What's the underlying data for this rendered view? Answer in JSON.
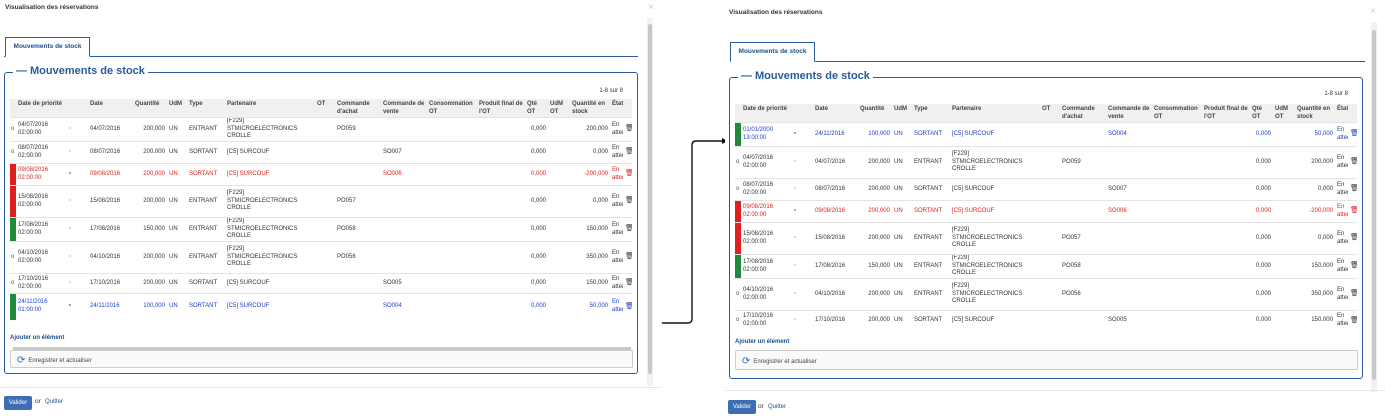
{
  "dialog_title": "Visualisation des réservations",
  "close_glyph": "×",
  "tab_label": "Mouvements de stock",
  "section_title": "Mouvements de stock",
  "count": "1-8 sur 8",
  "columns": [
    "Date de priorité",
    "Date",
    "Quantité",
    "UdM",
    "Type",
    "Partenaire",
    "OT",
    "Commande d'achat",
    "Commande de vente",
    "Consommation OT",
    "Produit final de l'OT",
    "Qté OT",
    "UdM OT",
    "Quantité en stock",
    "État"
  ],
  "add_item": "Ajouter un élément",
  "save_button": "Enregistrer et actualiser",
  "validate_button": "Valider",
  "or_text": "or",
  "quit_link": "Quitter",
  "row_colors": {
    "red": "#e02020",
    "green": "#1e8a3a",
    "blue": "#1a3ec8"
  },
  "left_rows": [
    {
      "bar": "",
      "style": "normal",
      "prio": "04/07/2016 02:00:00",
      "date": "04/07/2016",
      "qty": "200,000",
      "udm": "UN",
      "type": "ENTRANT",
      "partner": "[F229] STMICROELECTRONICS CROLLE",
      "po": "PO059",
      "so": "",
      "qte_ot": "0,000",
      "stock": "200,000",
      "state": "En attente"
    },
    {
      "bar": "",
      "style": "normal",
      "prio": "08/07/2016 02:00:00",
      "date": "08/07/2016",
      "qty": "200,000",
      "udm": "UN",
      "type": "SORTANT",
      "partner": "[C5] SURCOUF",
      "po": "",
      "so": "SO007",
      "qte_ot": "0,000",
      "stock": "0,000",
      "state": "En attente"
    },
    {
      "bar": "red",
      "style": "red",
      "prio": "09/08/2016 02:00:00",
      "date": "09/08/2016",
      "qty": "200,000",
      "udm": "UN",
      "type": "SORTANT",
      "partner": "[C5] SURCOUF",
      "po": "",
      "so": "SO006",
      "qte_ot": "0,000",
      "stock": "-200,000",
      "state": "En attente"
    },
    {
      "bar": "red",
      "style": "normal",
      "prio": "15/08/2016 02:00:00",
      "date": "15/08/2016",
      "qty": "200,000",
      "udm": "UN",
      "type": "ENTRANT",
      "partner": "[F229] STMICROELECTRONICS CROLLE",
      "po": "PO057",
      "so": "",
      "qte_ot": "0,000",
      "stock": "0,000",
      "state": "En attente"
    },
    {
      "bar": "green",
      "style": "normal",
      "prio": "17/08/2016 02:00:00",
      "date": "17/08/2016",
      "qty": "150,000",
      "udm": "UN",
      "type": "ENTRANT",
      "partner": "[F229] STMICROELECTRONICS CROLLE",
      "po": "PO058",
      "so": "",
      "qte_ot": "0,000",
      "stock": "150,000",
      "state": "En attente"
    },
    {
      "bar": "",
      "style": "normal",
      "prio": "04/10/2016 02:00:00",
      "date": "04/10/2016",
      "qty": "200,000",
      "udm": "UN",
      "type": "ENTRANT",
      "partner": "[F229] STMICROELECTRONICS CROLLE",
      "po": "PO056",
      "so": "",
      "qte_ot": "0,000",
      "stock": "350,000",
      "state": "En attente"
    },
    {
      "bar": "",
      "style": "normal",
      "prio": "17/10/2016 02:00:00",
      "date": "17/10/2016",
      "qty": "200,000",
      "udm": "UN",
      "type": "SORTANT",
      "partner": "[C5] SURCOUF",
      "po": "",
      "so": "SO005",
      "qte_ot": "0,000",
      "stock": "150,000",
      "state": "En attente"
    },
    {
      "bar": "green",
      "style": "blue",
      "prio": "24/11/2016 01:00:00",
      "date": "24/11/2016",
      "qty": "100,000",
      "udm": "UN",
      "type": "SORTANT",
      "partner": "[C5] SURCOUF",
      "po": "",
      "so": "SO004",
      "qte_ot": "0,000",
      "stock": "50,000",
      "state": "En attente"
    }
  ],
  "right_rows": [
    {
      "bar": "green",
      "style": "blue",
      "prio": "01/01/2000 13:00:00",
      "date": "24/11/2016",
      "qty": "100,000",
      "udm": "UN",
      "type": "SORTANT",
      "partner": "[C5] SURCOUF",
      "po": "",
      "so": "SO004",
      "qte_ot": "0,000",
      "stock": "50,000",
      "state": "En attente"
    },
    {
      "bar": "",
      "style": "normal",
      "prio": "04/07/2016 02:00:00",
      "date": "04/07/2016",
      "qty": "200,000",
      "udm": "UN",
      "type": "ENTRANT",
      "partner": "[F229] STMICROELECTRONICS CROLLE",
      "po": "PO059",
      "so": "",
      "qte_ot": "0,000",
      "stock": "200,000",
      "state": "En attente"
    },
    {
      "bar": "",
      "style": "normal",
      "prio": "08/07/2016 02:00:00",
      "date": "08/07/2016",
      "qty": "200,000",
      "udm": "UN",
      "type": "SORTANT",
      "partner": "[C5] SURCOUF",
      "po": "",
      "so": "SO007",
      "qte_ot": "0,000",
      "stock": "0,000",
      "state": "En attente"
    },
    {
      "bar": "red",
      "style": "red",
      "prio": "09/08/2016 02:00:00",
      "date": "09/08/2016",
      "qty": "200,000",
      "udm": "UN",
      "type": "SORTANT",
      "partner": "[C5] SURCOUF",
      "po": "",
      "so": "SO006",
      "qte_ot": "0,000",
      "stock": "-200,000",
      "state": "En attente"
    },
    {
      "bar": "red",
      "style": "normal",
      "prio": "15/08/2016 02:00:00",
      "date": "15/08/2016",
      "qty": "200,000",
      "udm": "UN",
      "type": "ENTRANT",
      "partner": "[F229] STMICROELECTRONICS CROLLE",
      "po": "PO057",
      "so": "",
      "qte_ot": "0,000",
      "stock": "0,000",
      "state": "En attente"
    },
    {
      "bar": "green",
      "style": "normal",
      "prio": "17/08/2016 02:00:00",
      "date": "17/08/2016",
      "qty": "150,000",
      "udm": "UN",
      "type": "ENTRANT",
      "partner": "[F229] STMICROELECTRONICS CROLLE",
      "po": "PO058",
      "so": "",
      "qte_ot": "0,000",
      "stock": "150,000",
      "state": "En attente"
    },
    {
      "bar": "",
      "style": "normal",
      "prio": "04/10/2016 02:00:00",
      "date": "04/10/2016",
      "qty": "200,000",
      "udm": "UN",
      "type": "ENTRANT",
      "partner": "[F229] STMICROELECTRONICS CROLLE",
      "po": "PO056",
      "so": "",
      "qte_ot": "0,000",
      "stock": "350,000",
      "state": "En attente"
    },
    {
      "bar": "",
      "style": "normal",
      "prio": "17/10/2016 02:00:00",
      "date": "17/10/2016",
      "qty": "200,000",
      "udm": "UN",
      "type": "SORTANT",
      "partner": "[C5] SURCOUF",
      "po": "",
      "so": "SO005",
      "qte_ot": "0,000",
      "stock": "150,000",
      "state": "En attente"
    }
  ]
}
